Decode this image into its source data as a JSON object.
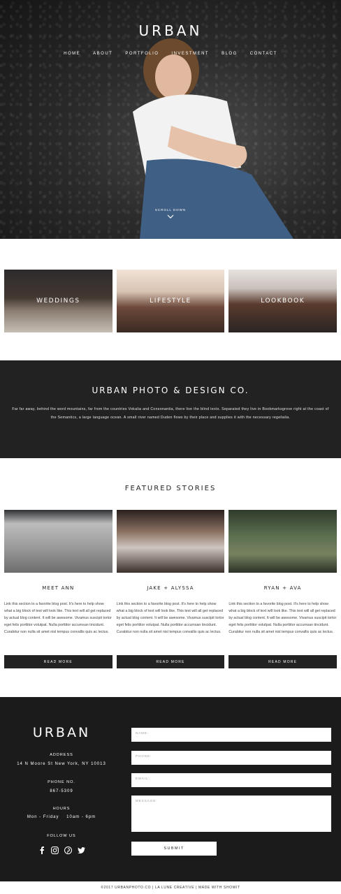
{
  "hero": {
    "logo": "URBAN",
    "nav": [
      "HOME",
      "ABOUT",
      "PORTFOLIO",
      "INVESTMENT",
      "BLOG",
      "CONTACT"
    ],
    "scroll_label": "SCROLL DOWN",
    "icon": "chevron-down-icon"
  },
  "categories": [
    {
      "label": "WEDDINGS"
    },
    {
      "label": "LIFESTYLE"
    },
    {
      "label": "LOOKBOOK"
    }
  ],
  "about": {
    "title": "URBAN PHOTO & DESIGN CO.",
    "body": "Far far away, behind the word mountains, far from the countries Vokalia and Consonantia, there live the blind texts. Separated they live in Bookmarksgrove right at the coast of the Semantics, a large language ocean. A small river named Duden flows by their place and supplies it with the necessary regelialia."
  },
  "featured": {
    "title": "FEATURED STORIES",
    "stories": [
      {
        "title": "MEET ANN",
        "excerpt": "Link this section to a favorite blog post. It's here to help show what a big block of text will look like. This text will all get replaced by actual blog content. It will be awesome. Vivamus suscipit tortor eget felis porttitor volutpat. Nulla porttitor accumsan tincidunt. Curabitur non nulla sit amet nisl tempus convallis quis ac lectus.",
        "button": "READ MORE"
      },
      {
        "title": "JAKE + ALYSSA",
        "excerpt": "Link this section to a favorite blog post. It's here to help show what a big block of text will look like. This text will all get replaced by actual blog content. It will be awesome. Vivamus suscipit tortor eget felis porttitor volutpat. Nulla porttitor accumsan tincidunt. Curabitur non nulla sit amet nisl tempus convallis quis ac lectus.",
        "button": "READ MORE"
      },
      {
        "title": "RYAN + AVA",
        "excerpt": "Link this section to a favorite blog post. It's here to help show what a big block of text will look like. This text will all get replaced by actual blog content. It will be awesome. Vivamus suscipit tortor eget felis porttitor volutpat. Nulla porttitor accumsan tincidunt. Curabitur non nulla sit amet nisl tempus convallis quis ac lectus.",
        "button": "READ MORE"
      }
    ]
  },
  "footer": {
    "logo": "URBAN",
    "address_label": "ADDRESS",
    "address": "14 N Moore St New York, NY 10013",
    "phone_label": "PHONE NO.",
    "phone": "867-5309",
    "hours_label": "HOURS",
    "hours": "Mon - Friday    10am - 6pm",
    "follow_label": "FOLLOW US",
    "social_icons": [
      "facebook-icon",
      "instagram-icon",
      "pinterest-icon",
      "twitter-icon"
    ],
    "form": {
      "name_placeholder": "NAME:",
      "phone_placeholder": "PHONE:",
      "email_placeholder": "EMAIL:",
      "message_placeholder": "MESSAGE:",
      "submit": "SUBMIT"
    }
  },
  "copyright": {
    "text": "©2017 URBANPHOTO.CO  |  LA LUNE CREATIVE  |  MADE WITH SHOWIT"
  },
  "colors": {
    "dark": "#222222",
    "footer": "#1b1b1b",
    "white": "#ffffff"
  }
}
